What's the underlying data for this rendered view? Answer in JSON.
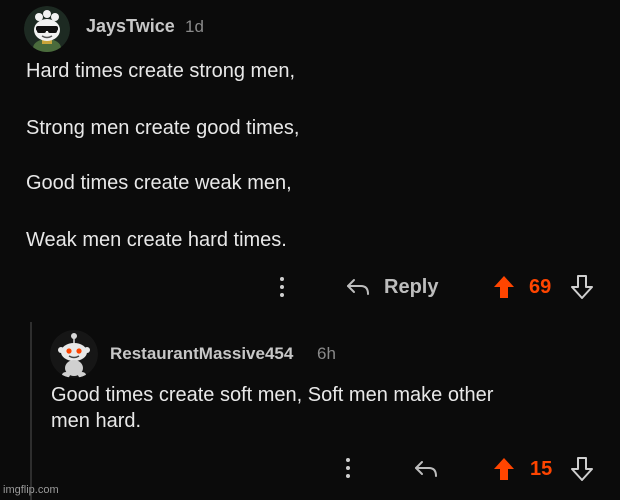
{
  "comments": [
    {
      "username": "JaysTwice",
      "age": "1d",
      "lines": [
        "Hard times create strong men,",
        "Strong men create good times,",
        "Good times create weak men,",
        "Weak men create hard times."
      ],
      "reply_label": "Reply",
      "score": "69",
      "avatar_icon": "sunglasses-avatar-icon"
    },
    {
      "username": "RestaurantMassive454",
      "age": "6h",
      "lines": [
        "Good times create soft men, Soft men make other",
        "men hard."
      ],
      "score": "15",
      "avatar_icon": "snoo-avatar-icon"
    }
  ],
  "colors": {
    "upvote": "#ff4500",
    "background": "#0b0b0b"
  },
  "watermark": "imgflip.com"
}
